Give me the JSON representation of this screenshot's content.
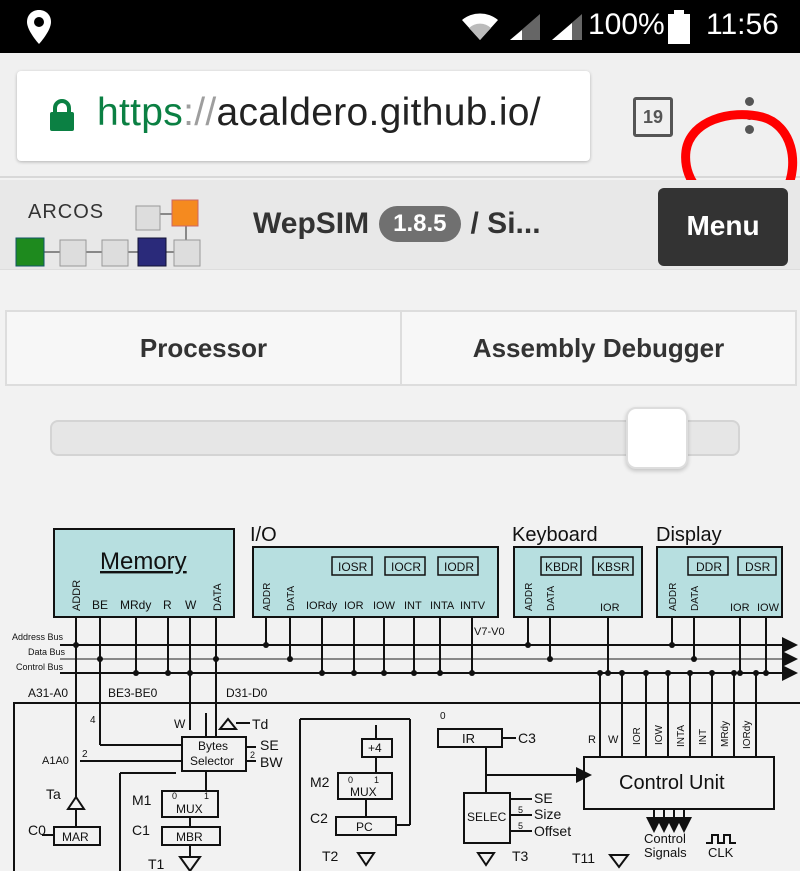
{
  "status_bar": {
    "battery_percent": "100%",
    "time": "11:56",
    "icons": [
      "location-icon",
      "wifi-icon",
      "signal-icon",
      "signal-icon",
      "battery-icon"
    ]
  },
  "browser": {
    "url_scheme": "https",
    "url_separator": "://",
    "url_host": "acaldero.github.io/",
    "tab_count": "19",
    "menu_icon": "more-vert-icon",
    "lock_color": "#0b8043"
  },
  "app": {
    "logo_text": "ARCOS",
    "name": "WepSIM",
    "version": "1.8.5",
    "title_suffix": "/ Si...",
    "menu_label": "Menu"
  },
  "tabs": [
    {
      "label": "Processor"
    },
    {
      "label": "Assembly Debugger"
    }
  ],
  "slider": {
    "value_fraction": 0.92
  },
  "diagram": {
    "memory": {
      "title": "Memory",
      "signals": [
        "ADDR",
        "BE",
        "MRdy",
        "R",
        "W",
        "DATA"
      ]
    },
    "io": {
      "title": "I/O",
      "registers": [
        "IOSR",
        "IOCR",
        "IODR"
      ],
      "signals": [
        "ADDR",
        "DATA",
        "IORdy",
        "IOR",
        "IOW",
        "INT",
        "INTA",
        "INTV"
      ]
    },
    "keyboard": {
      "title": "Keyboard",
      "registers": [
        "KBDR",
        "KBSR"
      ],
      "signals": [
        "ADDR",
        "DATA",
        "IOR"
      ]
    },
    "display": {
      "title": "Display",
      "registers": [
        "DDR",
        "DSR"
      ],
      "signals": [
        "ADDR",
        "DATA",
        "IOR",
        "IOW"
      ]
    },
    "buses": [
      "Address Bus",
      "Data Bus",
      "Control Bus"
    ],
    "labels": {
      "v7v0": "V7-V0",
      "a31a0": "A31-A0",
      "be3be0": "BE3-BE0",
      "d31d0": "D31-D0",
      "td": "Td",
      "bytes_selector_1": "Bytes",
      "bytes_selector_2": "Selector",
      "se": "SE",
      "bw": "BW",
      "w": "W",
      "four": "4",
      "two": "2",
      "two_b": "2",
      "a1a0": "A1A0",
      "ta": "Ta",
      "c0": "C0",
      "mar": "MAR",
      "m1": "M1",
      "mux": "MUX",
      "zero": "0",
      "one": "1",
      "c1": "C1",
      "mbr": "MBR",
      "t1": "T1",
      "plus4": "+4",
      "m2": "M2",
      "c2": "C2",
      "pc": "PC",
      "t2": "T2",
      "ir_zero": "0",
      "ir": "IR",
      "c3": "C3",
      "selec": "SELEC",
      "sel_se": "SE",
      "size": "Size",
      "offset": "Offset",
      "five_a": "5",
      "five_b": "5",
      "t3": "T3",
      "control_unit": "Control Unit",
      "cu_signals": [
        "R",
        "W",
        "IOR",
        "IOW",
        "INTA",
        "INT",
        "MRdy",
        "IORdy"
      ],
      "t11": "T11",
      "control": "Control",
      "signals": "Signals",
      "clk": "CLK"
    }
  }
}
